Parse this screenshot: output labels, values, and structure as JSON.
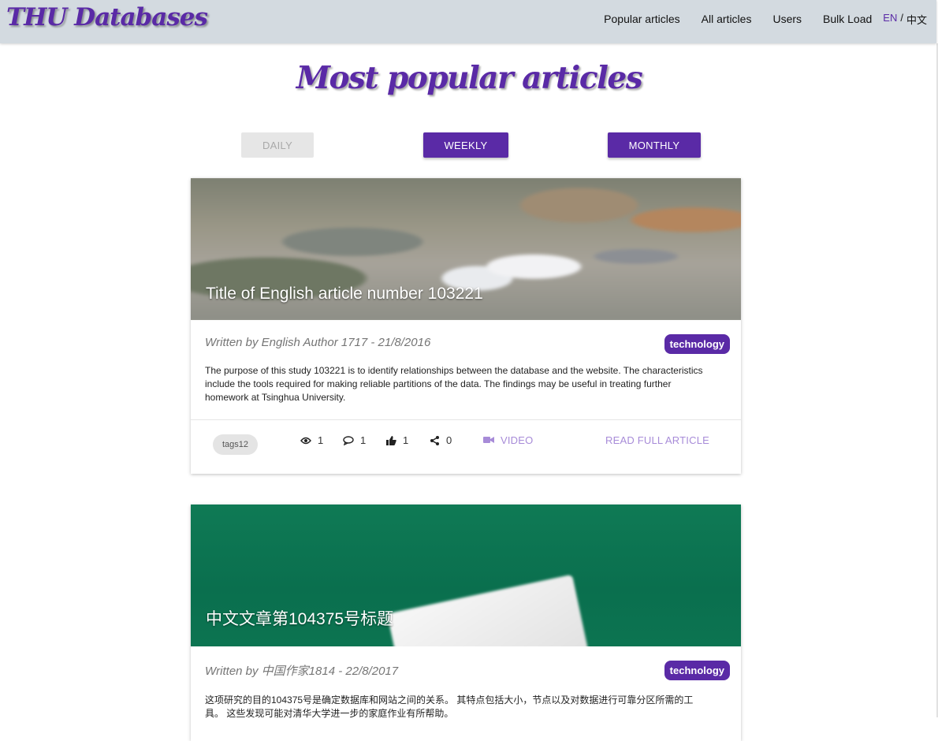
{
  "nav": {
    "brand": "THU Databases",
    "links": [
      "Popular articles",
      "All articles",
      "Users",
      "Bulk Load"
    ],
    "lang_en": "EN",
    "lang_sep": "/",
    "lang_zh": "中文"
  },
  "page": {
    "title": "Most popular articles"
  },
  "periods": {
    "daily": "DAILY",
    "weekly": "WEEKLY",
    "monthly": "MONTHLY",
    "disabled": "daily"
  },
  "articles": [
    {
      "title": "Title of English article number 103221",
      "author_line": "Written by English Author 1717 - 21/8/2016",
      "category": "technology",
      "abstract": "The purpose of this study 103221 is to identify relationships between the database and the website. The characteristics include the tools required for making reliable partitions of the data. The findings may be useful in treating further homework at Tsinghua University.",
      "tag": "tags12",
      "views": "1",
      "comments": "1",
      "likes": "1",
      "shares": "0",
      "video_label": "VIDEO",
      "read_more": "READ FULL ARTICLE"
    },
    {
      "title": "中文文章第104375号标题",
      "author_line": "Written by 中国作家1814 - 22/8/2017",
      "category": "technology",
      "abstract": "这项研究的目的104375号是确定数据库和网站之间的关系。 其特点包括大小，节点以及对数据进行可靠分区所需的工具。 这些发现可能对清华大学进一步的家庭作业有所帮助。"
    }
  ],
  "colors": {
    "accent": "#5a2aa6",
    "navbar_bg": "#d3dae0",
    "link_light": "#a78bd8"
  }
}
